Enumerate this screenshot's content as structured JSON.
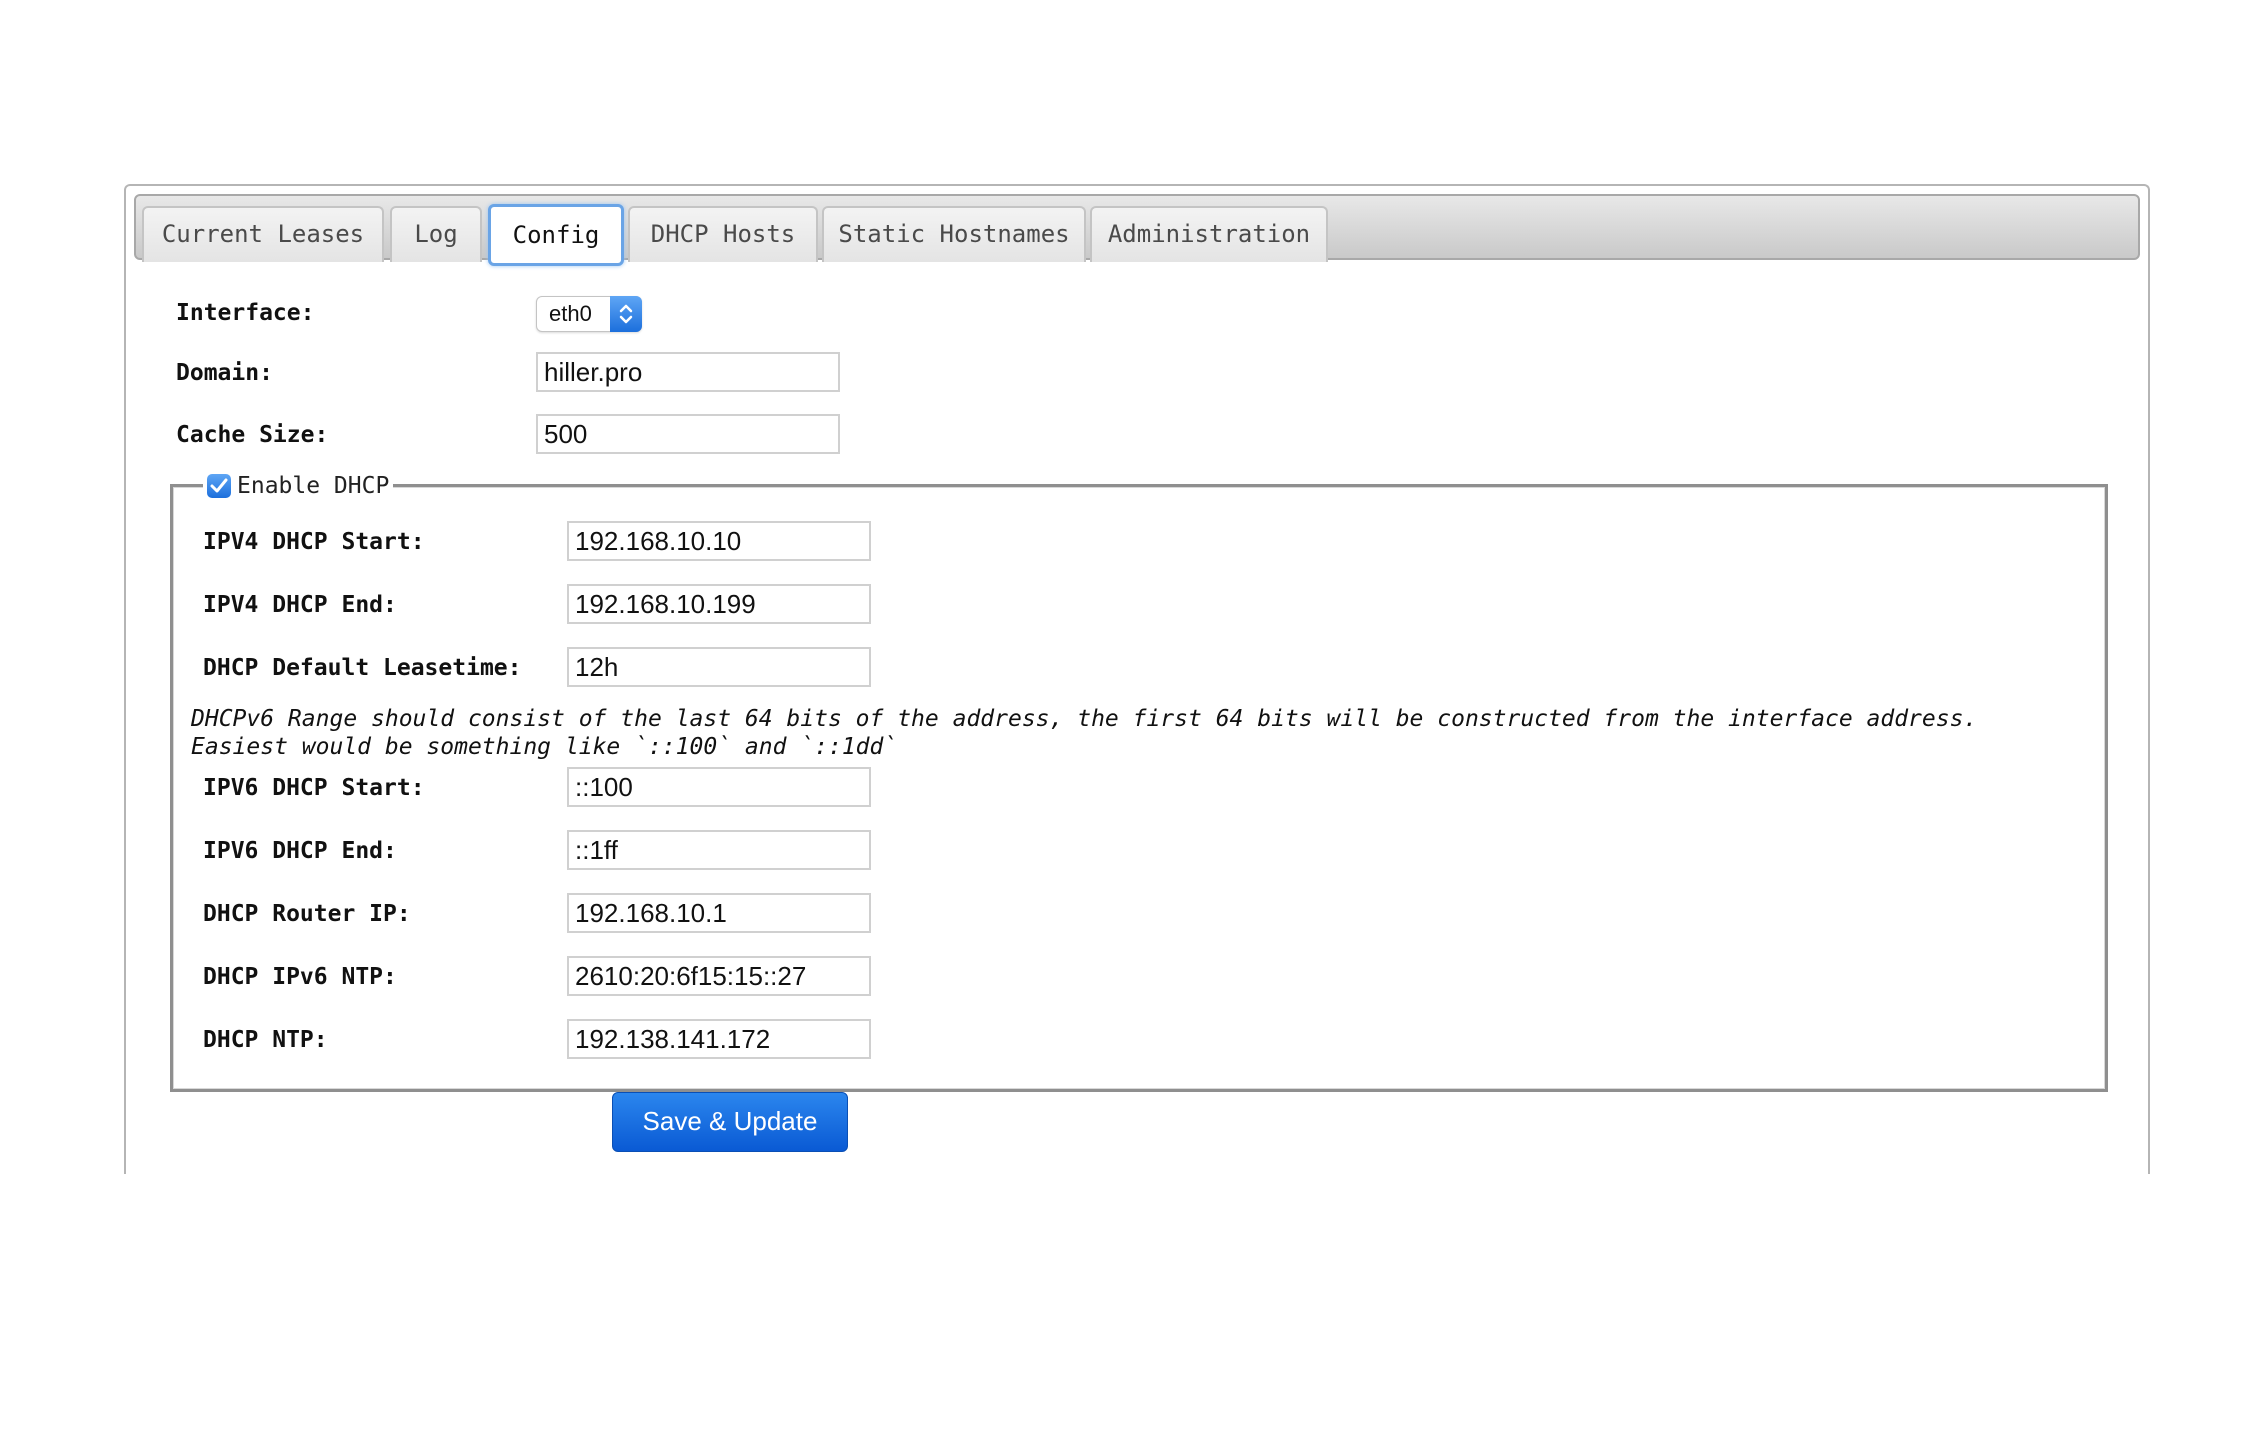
{
  "tabs": [
    {
      "label": "Current Leases",
      "active": false
    },
    {
      "label": "Log",
      "active": false
    },
    {
      "label": "Config",
      "active": true
    },
    {
      "label": "DHCP Hosts",
      "active": false
    },
    {
      "label": "Static Hostnames",
      "active": false
    },
    {
      "label": "Administration",
      "active": false
    }
  ],
  "config": {
    "interface_label": "Interface:",
    "interface_value": "eth0",
    "domain_label": "Domain:",
    "domain_value": "hiller.pro",
    "cache_size_label": "Cache Size:",
    "cache_size_value": "500"
  },
  "dhcp": {
    "enable_label": "Enable DHCP",
    "enabled": true,
    "ipv4_start_label": "IPV4 DHCP Start:",
    "ipv4_start_value": "192.168.10.10",
    "ipv4_end_label": "IPV4 DHCP End:",
    "ipv4_end_value": "192.168.10.199",
    "leasetime_label": "DHCP Default Leasetime:",
    "leasetime_value": "12h",
    "note_line1": "DHCPv6 Range should consist of the last 64 bits of the address, the first 64 bits will be constructed from the interface address.",
    "note_line2": "Easiest would be something like `::100` and `::1dd`",
    "ipv6_start_label": "IPV6 DHCP Start:",
    "ipv6_start_value": "::100",
    "ipv6_end_label": "IPV6 DHCP End:",
    "ipv6_end_value": "::1ff",
    "router_ip_label": "DHCP Router IP:",
    "router_ip_value": "192.168.10.1",
    "ipv6_ntp_label": "DHCP IPv6 NTP:",
    "ipv6_ntp_value": "2610:20:6f15:15::27",
    "ntp_label": "DHCP NTP:",
    "ntp_value": "192.138.141.172"
  },
  "actions": {
    "save_label": "Save & Update"
  },
  "colors": {
    "accent": "#1c6fdc",
    "active_tab_border": "#6aa4e6"
  }
}
